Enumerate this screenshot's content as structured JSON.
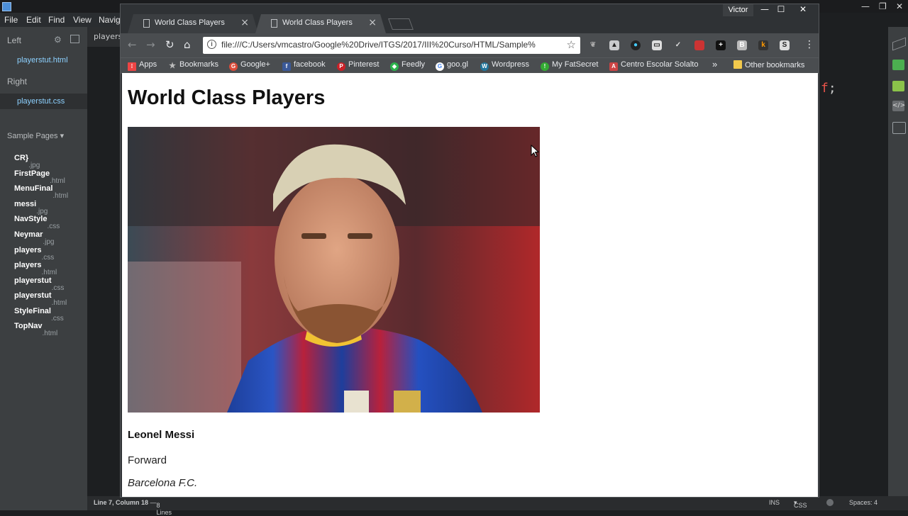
{
  "editor": {
    "menu": [
      "File",
      "Edit",
      "Find",
      "View",
      "Navig"
    ],
    "sidebar": {
      "left_label": "Left",
      "left_file": "playerstut.html",
      "right_label": "Right",
      "right_file": "playerstut.css",
      "project_label": "Sample Pages",
      "files": [
        {
          "name": "CR}",
          "ext": ".jpg"
        },
        {
          "name": "FirstPage",
          "ext": ".html"
        },
        {
          "name": "MenuFinal",
          "ext": ".html"
        },
        {
          "name": "messi",
          "ext": ".jpg"
        },
        {
          "name": "NavStyle",
          "ext": ".css"
        },
        {
          "name": "Neymar",
          "ext": ".jpg"
        },
        {
          "name": "players",
          "ext": ".css"
        },
        {
          "name": "players",
          "ext": ".html"
        },
        {
          "name": "playerstut",
          "ext": ".css"
        },
        {
          "name": "playerstut",
          "ext": ".html"
        },
        {
          "name": "StyleFinal",
          "ext": ".css"
        },
        {
          "name": "TopNav",
          "ext": ".html"
        }
      ]
    },
    "tab_label": "players",
    "code_snippet": "f;",
    "status": {
      "position": "Line 7, Column 18",
      "lines": "8 Lines",
      "ins": "INS",
      "lang": "CSS",
      "spaces": "Spaces: 4"
    }
  },
  "browser": {
    "user": "Victor",
    "tabs": [
      {
        "title": "World Class Players",
        "active": false
      },
      {
        "title": "World Class Players",
        "active": true
      }
    ],
    "url": "file:///C:/Users/vmcastro/Google%20Drive/ITGS/2017/III%20Curso/HTML/Sample%",
    "bookmarks": [
      {
        "label": "Apps",
        "icon": "apps-icon"
      },
      {
        "label": "Bookmarks",
        "icon": "star-icon"
      },
      {
        "label": "Google+",
        "icon": "google-plus-icon"
      },
      {
        "label": "facebook",
        "icon": "facebook-icon"
      },
      {
        "label": "Pinterest",
        "icon": "pinterest-icon"
      },
      {
        "label": "Feedly",
        "icon": "feedly-icon"
      },
      {
        "label": "goo.gl",
        "icon": "google-icon"
      },
      {
        "label": "Wordpress",
        "icon": "wordpress-icon"
      },
      {
        "label": "My FatSecret",
        "icon": "fatsecret-icon"
      },
      {
        "label": "Centro Escolar Solalto",
        "icon": "school-icon"
      }
    ],
    "overflow": "»",
    "other_bookmarks": "Other bookmarks"
  },
  "page": {
    "heading": "World Class Players",
    "player_name": "Leonel Messi",
    "position": "Forward",
    "club": "Barcelona F.C."
  }
}
